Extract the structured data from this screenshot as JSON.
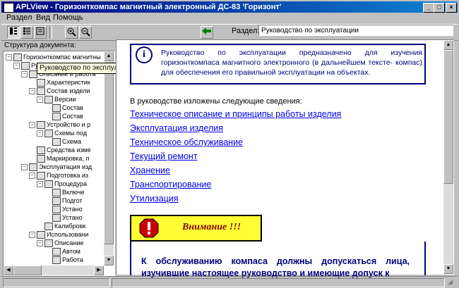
{
  "window": {
    "title": "APLView - Горизонткомпас магнитный электронный ДС-83 'Горизонт'",
    "buttons": {
      "minimize": "_",
      "maximize": "□",
      "close": "×"
    }
  },
  "menu": [
    "Раздел",
    "Вид",
    "Помощь"
  ],
  "toolbar": {
    "section_label": "Раздел:",
    "section_value": "Руководство по эксплуатации"
  },
  "tree": {
    "label": "Структура документа:",
    "tooltip": "Руководство по эксплуатации",
    "nodes": [
      {
        "text": "Горизонткомпас магнитны",
        "expander": "−",
        "level": 0
      },
      {
        "text": "Руководство по эксплуатации",
        "expander": "−",
        "level": 1
      },
      {
        "text": "Описание и работа",
        "expander": "−",
        "level": 2
      },
      {
        "text": "Характеристик",
        "expander": "",
        "level": 3
      },
      {
        "text": "Состав издели",
        "expander": "−",
        "level": 3
      },
      {
        "text": "Версии",
        "expander": "−",
        "level": 4
      },
      {
        "text": "Состав",
        "expander": "",
        "level": 5
      },
      {
        "text": "Состав",
        "expander": "",
        "level": 5
      },
      {
        "text": "Устройство и р",
        "expander": "−",
        "level": 3
      },
      {
        "text": "Схемы под",
        "expander": "−",
        "level": 4
      },
      {
        "text": "Схема",
        "expander": "",
        "level": 5
      },
      {
        "text": "Средства изме",
        "expander": "",
        "level": 3
      },
      {
        "text": "Маркировка, п",
        "expander": "",
        "level": 3
      },
      {
        "text": "Эксплуатация изд",
        "expander": "−",
        "level": 2
      },
      {
        "text": "Подготовка из",
        "expander": "−",
        "level": 3
      },
      {
        "text": "Процедура",
        "expander": "−",
        "level": 4
      },
      {
        "text": "Включе",
        "expander": "",
        "level": 5
      },
      {
        "text": "Подгот",
        "expander": "",
        "level": 5
      },
      {
        "text": "Устано",
        "expander": "",
        "level": 5
      },
      {
        "text": "Устано",
        "expander": "",
        "level": 5
      },
      {
        "text": "Калибровк",
        "expander": "",
        "level": 4
      },
      {
        "text": "Использовани",
        "expander": "−",
        "level": 3
      },
      {
        "text": "Описание",
        "expander": "−",
        "level": 4
      },
      {
        "text": "Автом",
        "expander": "",
        "level": 5
      },
      {
        "text": "Работа",
        "expander": "",
        "level": 5
      }
    ]
  },
  "doc": {
    "info_text": "Руководство по эксплуатации предназначено для изучения горизонткомпаса магнитного электронного (в дальнейшем тексте- компас) для обеспечения его правильной эксплуатации на объектах.",
    "intro": "В руководстве изложены следующие сведения:",
    "links": [
      "Техническое описание и принципы работы изделия",
      "Эксплуатация изделия",
      "Техническое обслуживание",
      "Текущий ремонт",
      "Хранение",
      "Транспортирование",
      "Утилизация"
    ],
    "warning_title": "Внимание !!!",
    "warning_text": "К обслуживанию компаса должны допускаться лица, изучившие настоящее руководство и имеющие допуск к"
  },
  "colors": {
    "title_bar": "#000080",
    "link": "#0000ee",
    "warning_bg": "#ffff33",
    "info_border": "#000080"
  }
}
